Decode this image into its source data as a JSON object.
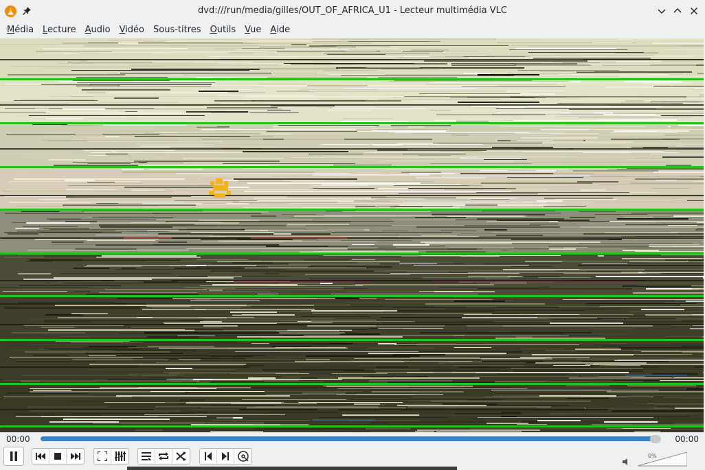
{
  "window": {
    "title": "dvd:///run/media/gilles/OUT_OF_AFRICA_U1 - Lecteur multimédia VLC",
    "app_icon": "vlc-cone-icon",
    "pin_icon": "pin-icon",
    "buttons": [
      "minimize-icon",
      "maximize-icon",
      "close-icon"
    ]
  },
  "menubar": {
    "items": [
      {
        "label": "Média",
        "mnemonic": "M",
        "rest": "édia"
      },
      {
        "label": "Lecture",
        "mnemonic": "L",
        "rest": "ecture"
      },
      {
        "label": "Audio",
        "mnemonic": "A",
        "rest": "udio"
      },
      {
        "label": "Vidéo",
        "mnemonic": "V",
        "rest": "idéo"
      },
      {
        "label": "Sous-titres",
        "mnemonic": "",
        "rest": "Sous-titres"
      },
      {
        "label": "Outils",
        "mnemonic": "O",
        "rest": "utils"
      },
      {
        "label": "Vue",
        "mnemonic": "V",
        "rest": "ue"
      },
      {
        "label": "Aide",
        "mnemonic": "A",
        "rest": "ide"
      }
    ]
  },
  "player": {
    "time_elapsed": "00:00",
    "time_total": "00:00",
    "progress": 1.0,
    "volume_label": "0%",
    "volume": 0
  },
  "controls": {
    "play_pause": "pause-icon",
    "transport": [
      "previous-icon",
      "stop-icon",
      "next-icon"
    ],
    "view": [
      "fullscreen-icon",
      "extended-settings-icon"
    ],
    "playlist": [
      "playlist-icon",
      "loop-icon",
      "shuffle-icon"
    ],
    "chapter": [
      "previous-chapter-icon",
      "next-chapter-icon",
      "disc-menu-icon"
    ],
    "volume_icon": "speaker-icon"
  },
  "colors": {
    "accent": "#3b82c4",
    "vlc_orange": "#f08a00",
    "window_bg": "#eff0f1"
  }
}
